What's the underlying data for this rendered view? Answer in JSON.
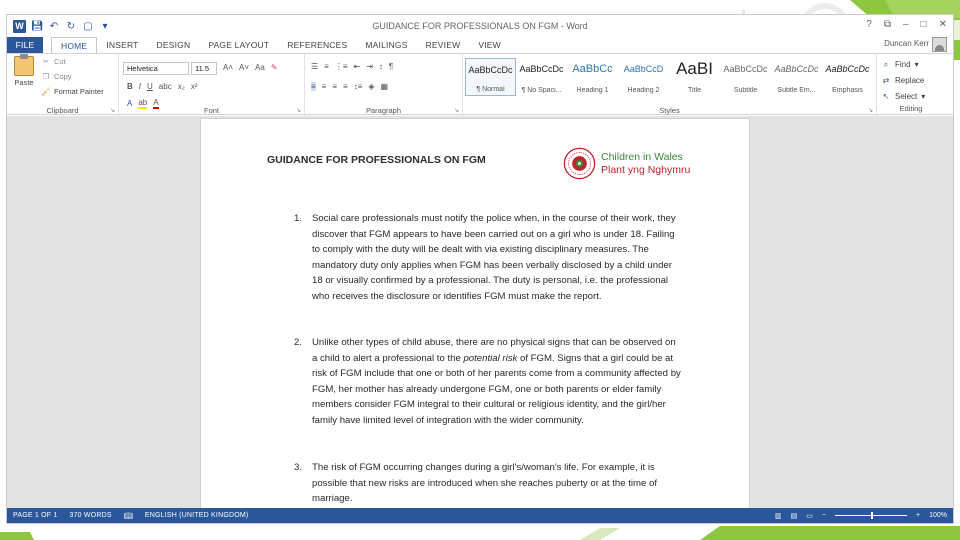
{
  "window": {
    "title": "GUIDANCE FOR PROFESSIONALS ON FGM - Word",
    "controls": [
      "?",
      "⧉",
      "–",
      "□",
      "✕"
    ]
  },
  "qat_icons": [
    "save-icon",
    "undo-icon",
    "redo-icon",
    "print-preview-icon",
    "customize-qat-icon"
  ],
  "tabs": [
    "FILE",
    "HOME",
    "INSERT",
    "DESIGN",
    "PAGE LAYOUT",
    "REFERENCES",
    "MAILINGS",
    "REVIEW",
    "VIEW"
  ],
  "active_tab": "HOME",
  "user": "Duncan Kerr",
  "ribbon": {
    "clipboard": {
      "label": "Clipboard",
      "paste": "Paste",
      "cut": "Cut",
      "copy": "Copy",
      "format_painter": "Format Painter"
    },
    "font": {
      "label": "Font",
      "font_name": "Helvetica",
      "font_size": "11.5"
    },
    "paragraph": {
      "label": "Paragraph"
    },
    "styles": {
      "label": "Styles",
      "items": [
        {
          "preview": "AaBbCcDc",
          "name": "¶ Normal"
        },
        {
          "preview": "AaBbCcDc",
          "name": "¶ No Spaci..."
        },
        {
          "preview": "AaBbCc",
          "name": "Heading 1"
        },
        {
          "preview": "AaBbCcD",
          "name": "Heading 2"
        },
        {
          "preview": "AaBI",
          "name": "Title"
        },
        {
          "preview": "AaBbCcDc",
          "name": "Subtitle"
        },
        {
          "preview": "AaBbCcDc",
          "name": "Subtle Em..."
        },
        {
          "preview": "AaBbCcDc",
          "name": "Emphasis"
        }
      ]
    },
    "editing": {
      "label": "Editing",
      "find": "Find",
      "replace": "Replace",
      "select": "Select"
    }
  },
  "document": {
    "title": "GUIDANCE FOR PROFESSIONALS ON FGM",
    "logo": {
      "line1": "Children in Wales",
      "line2": "Plant yng Nghymru"
    },
    "items": [
      {
        "num": "1.",
        "text": "Social care professionals must notify the police when, in the course of their work, they discover that FGM appears to have been carried out on a girl who is under 18. Failing to comply with the duty will be dealt with via existing disciplinary measures. The mandatory duty only applies when FGM has been verbally disclosed by a child under 18 or visually confirmed by a professional. The duty is personal, i.e. the professional who receives the disclosure or identifies FGM must make the report."
      },
      {
        "num": "2.",
        "text_before": "Unlike other types of child abuse, there are no physical signs that can be observed on a child to alert a professional to the ",
        "text_italic": "potential risk",
        "text_after": " of FGM. Signs that a girl could be at risk of FGM include that one or both of her parents come from a community affected by FGM, her mother has already undergone FGM, one or both parents or elder family members consider FGM integral to their cultural or religious identity, and the girl/her family have limited level of integration with the wider community."
      },
      {
        "num": "3.",
        "text": "The risk of FGM occurring changes during a girl's/woman's life. For example, it is possible that new risks are introduced when she reaches puberty or at the time of marriage."
      }
    ]
  },
  "statusbar": {
    "page": "PAGE 1 OF 1",
    "words": "370 WORDS",
    "language": "ENGLISH (UNITED KINGDOM)",
    "zoom": "100%",
    "zoom_level": 0.5
  },
  "colors": {
    "accent": "#2b579a",
    "deco_green": "#8dc63f",
    "logo_green": "#3c8a3a",
    "logo_red": "#c2212d"
  }
}
